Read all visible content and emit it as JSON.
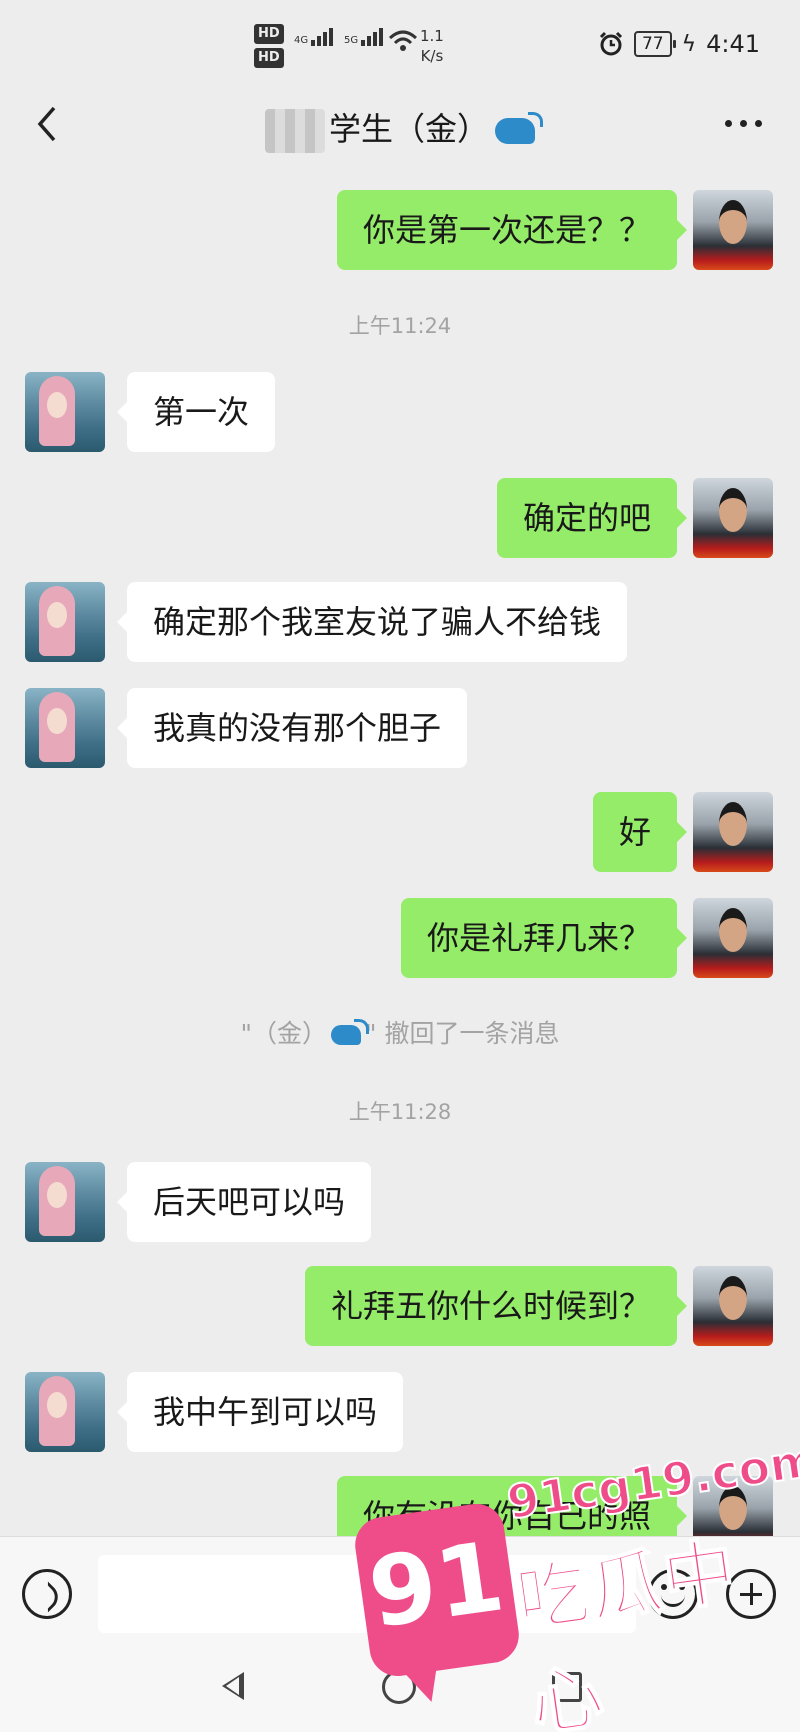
{
  "status_bar": {
    "hd1": "HD",
    "hd2": "HD",
    "net1": "4G",
    "net2": "5G",
    "speed_value": "1.1",
    "speed_unit": "K/s",
    "battery": "77",
    "time": "4:41"
  },
  "header": {
    "title": "学生（金）"
  },
  "messages": [
    {
      "side": "me",
      "text": "你是第一次还是？？"
    },
    {
      "type": "time",
      "text": "上午11:24"
    },
    {
      "side": "them",
      "text": "第一次"
    },
    {
      "side": "me",
      "text": "确定的吧"
    },
    {
      "side": "them",
      "text": "确定那个我室友说了骗人不给钱"
    },
    {
      "side": "them",
      "text": "我真的没有那个胆子"
    },
    {
      "side": "me",
      "text": "好"
    },
    {
      "side": "me",
      "text": "你是礼拜几来？"
    },
    {
      "type": "system",
      "prefix": "\"（金）",
      "suffix": "\" 撤回了一条消息"
    },
    {
      "type": "time",
      "text": "上午11:28"
    },
    {
      "side": "them",
      "text": "后天吧可以吗"
    },
    {
      "side": "me",
      "text": "礼拜五你什么时候到？"
    },
    {
      "side": "them",
      "text": "我中午到可以吗"
    },
    {
      "side": "me",
      "text": "你有没有你自己的照"
    }
  ],
  "input_bar": {
    "value": ""
  },
  "watermark": {
    "badge": "91",
    "url": "91cg19.com",
    "text": "吃瓜中心"
  },
  "colors": {
    "background": "#ededed",
    "bubble_me": "#95ec69",
    "bubble_them": "#ffffff",
    "watermark": "#ee4d8a"
  }
}
